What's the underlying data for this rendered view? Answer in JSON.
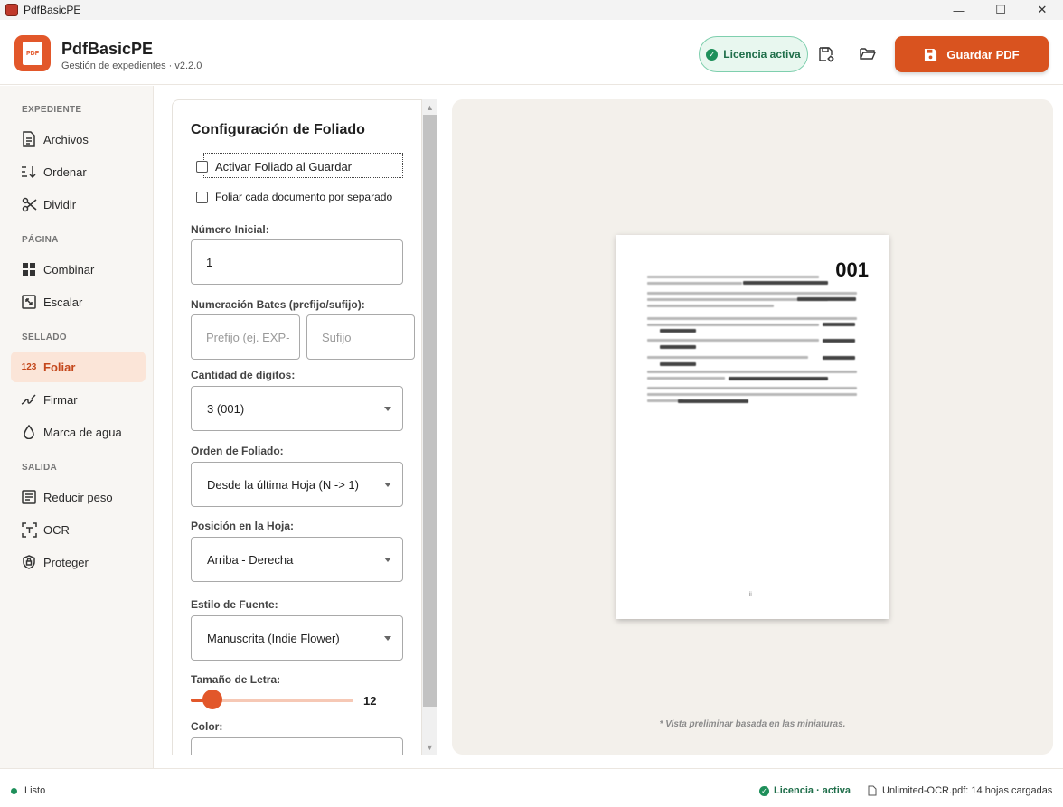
{
  "window": {
    "title": "PdfBasicPE",
    "minimize": "—",
    "maximize": "☐",
    "close": "✕"
  },
  "header": {
    "app_name": "PdfBasicPE",
    "subtitle": "Gestión de expedientes · v2.2.0",
    "logo_text": "PDF",
    "license_label": "Licencia activa",
    "save_label": "Guardar PDF"
  },
  "sidebar": {
    "sections": [
      {
        "label": "EXPEDIENTE",
        "items": [
          {
            "label": "Archivos",
            "icon": "file-icon"
          },
          {
            "label": "Ordenar",
            "icon": "sort-icon"
          },
          {
            "label": "Dividir",
            "icon": "scissors-icon"
          }
        ]
      },
      {
        "label": "PÁGINA",
        "items": [
          {
            "label": "Combinar",
            "icon": "grid-icon"
          },
          {
            "label": "Escalar",
            "icon": "scale-icon"
          }
        ]
      },
      {
        "label": "SELLADO",
        "items": [
          {
            "label": "Foliar",
            "icon": "numbers-icon",
            "icon_text": "123",
            "active": true
          },
          {
            "label": "Firmar",
            "icon": "signature-icon"
          },
          {
            "label": "Marca de agua",
            "icon": "drop-icon"
          }
        ]
      },
      {
        "label": "SALIDA",
        "items": [
          {
            "label": "Reducir peso",
            "icon": "compress-icon"
          },
          {
            "label": "OCR",
            "icon": "ocr-icon"
          },
          {
            "label": "Proteger",
            "icon": "shield-icon"
          }
        ]
      }
    ]
  },
  "config": {
    "title": "Configuración de Foliado",
    "activate_label": "Activar Foliado al Guardar",
    "separate_label": "Foliar cada documento por separado",
    "initial_number_label": "Número Inicial:",
    "initial_number_value": "1",
    "bates_label": "Numeración Bates (prefijo/sufijo):",
    "prefix_placeholder": "Prefijo (ej. EXP-",
    "suffix_placeholder": "Sufijo",
    "digits_label": "Cantidad de dígitos:",
    "digits_value": "3 (001)",
    "order_label": "Orden de Foliado:",
    "order_value": "Desde la última Hoja (N -> 1)",
    "position_label": "Posición en la Hoja:",
    "position_value": "Arriba - Derecha",
    "font_label": "Estilo de Fuente:",
    "font_value": "Manuscrita (Indie Flower)",
    "size_label": "Tamaño de Letra:",
    "size_value": "12",
    "size_fraction": 0.09,
    "color_label": "Color:"
  },
  "preview": {
    "folio": "001",
    "note": "* Vista preliminar basada en las miniaturas.",
    "page_number": "ii"
  },
  "status": {
    "ready": "Listo",
    "license": "Licencia · activa",
    "file": "Unlimited-OCR.pdf: 14 hojas cargadas"
  },
  "colors": {
    "accent": "#e2572a",
    "success": "#1e8f5a",
    "active_bg": "#fbe5d8"
  }
}
